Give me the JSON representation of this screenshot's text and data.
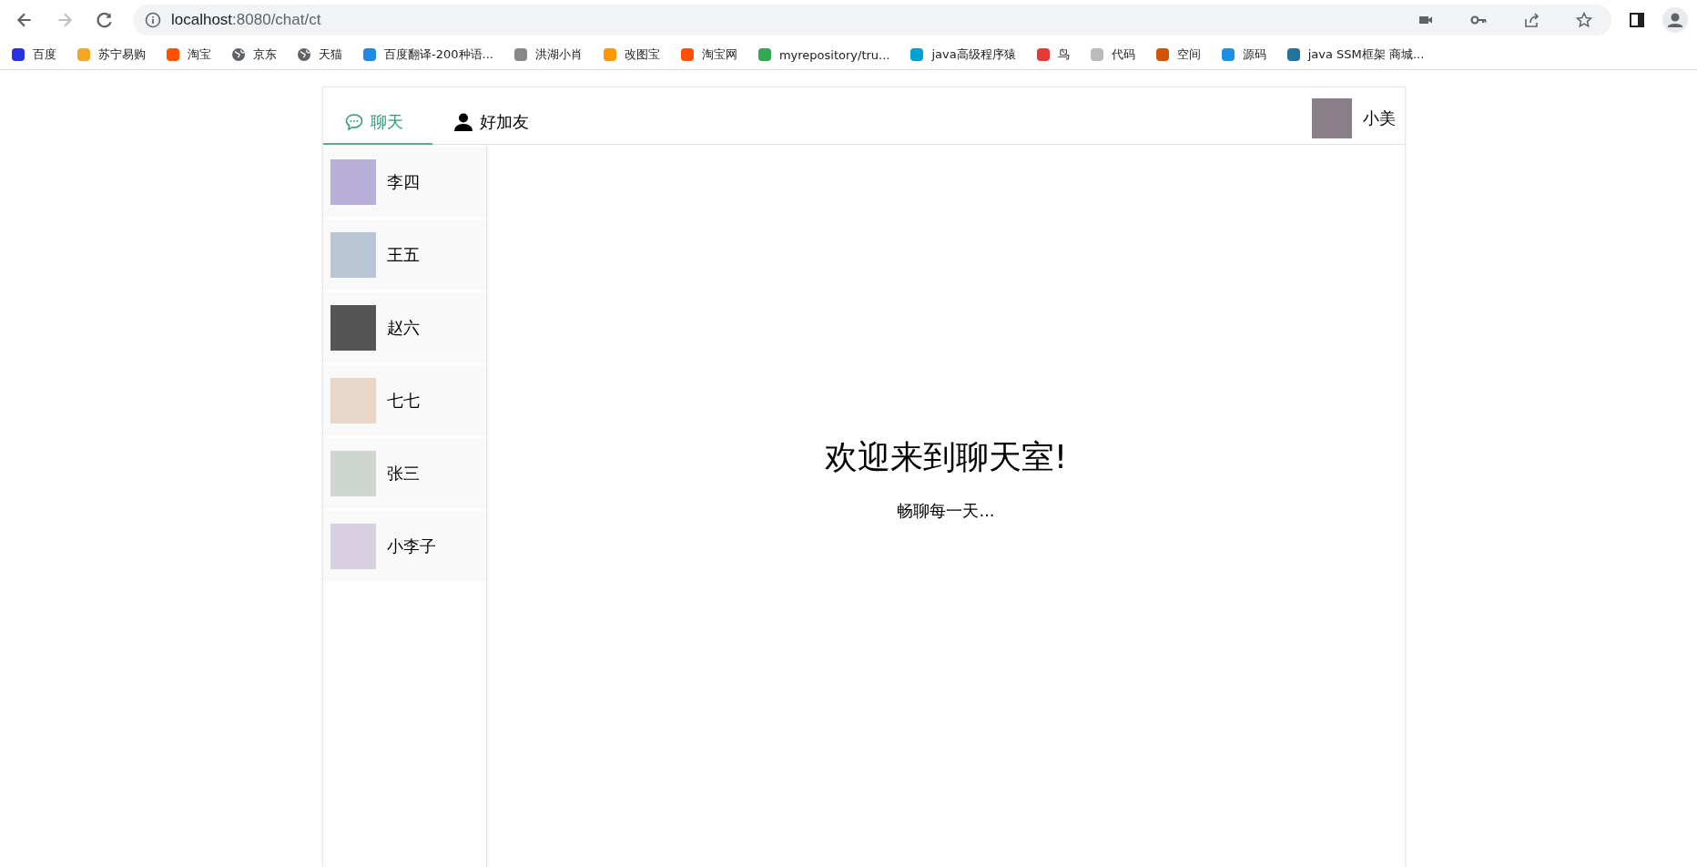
{
  "browser": {
    "url_host": "localhost",
    "url_path": ":8080/chat/ct",
    "forward_disabled": true
  },
  "bookmarks": [
    {
      "label": "百度",
      "kind": "site"
    },
    {
      "label": "苏宁易购",
      "kind": "site"
    },
    {
      "label": "淘宝",
      "kind": "site"
    },
    {
      "label": "京东",
      "kind": "globe"
    },
    {
      "label": "天猫",
      "kind": "globe"
    },
    {
      "label": "百度翻译-200种语...",
      "kind": "site"
    },
    {
      "label": "洪湖小肖",
      "kind": "site"
    },
    {
      "label": "改图宝",
      "kind": "site"
    },
    {
      "label": "淘宝网",
      "kind": "site"
    },
    {
      "label": "myrepository/tru...",
      "kind": "site"
    },
    {
      "label": "java高级程序猿",
      "kind": "site"
    },
    {
      "label": "鸟",
      "kind": "site"
    },
    {
      "label": "代码",
      "kind": "site"
    },
    {
      "label": "空间",
      "kind": "site"
    },
    {
      "label": "源码",
      "kind": "site"
    },
    {
      "label": "java SSM框架 商城...",
      "kind": "site"
    }
  ],
  "tabs": [
    {
      "label": "聊天",
      "kind": "chat",
      "selected": true
    },
    {
      "label": "好加友",
      "kind": "person",
      "selected": false
    }
  ],
  "user": {
    "name": "小美"
  },
  "contacts": [
    {
      "name": "李四"
    },
    {
      "name": "王五"
    },
    {
      "name": "赵六"
    },
    {
      "name": "七七"
    },
    {
      "name": "张三"
    },
    {
      "name": "小李子"
    }
  ],
  "welcome": {
    "title": "欢迎来到聊天室!",
    "subtitle": "畅聊每一天..."
  }
}
